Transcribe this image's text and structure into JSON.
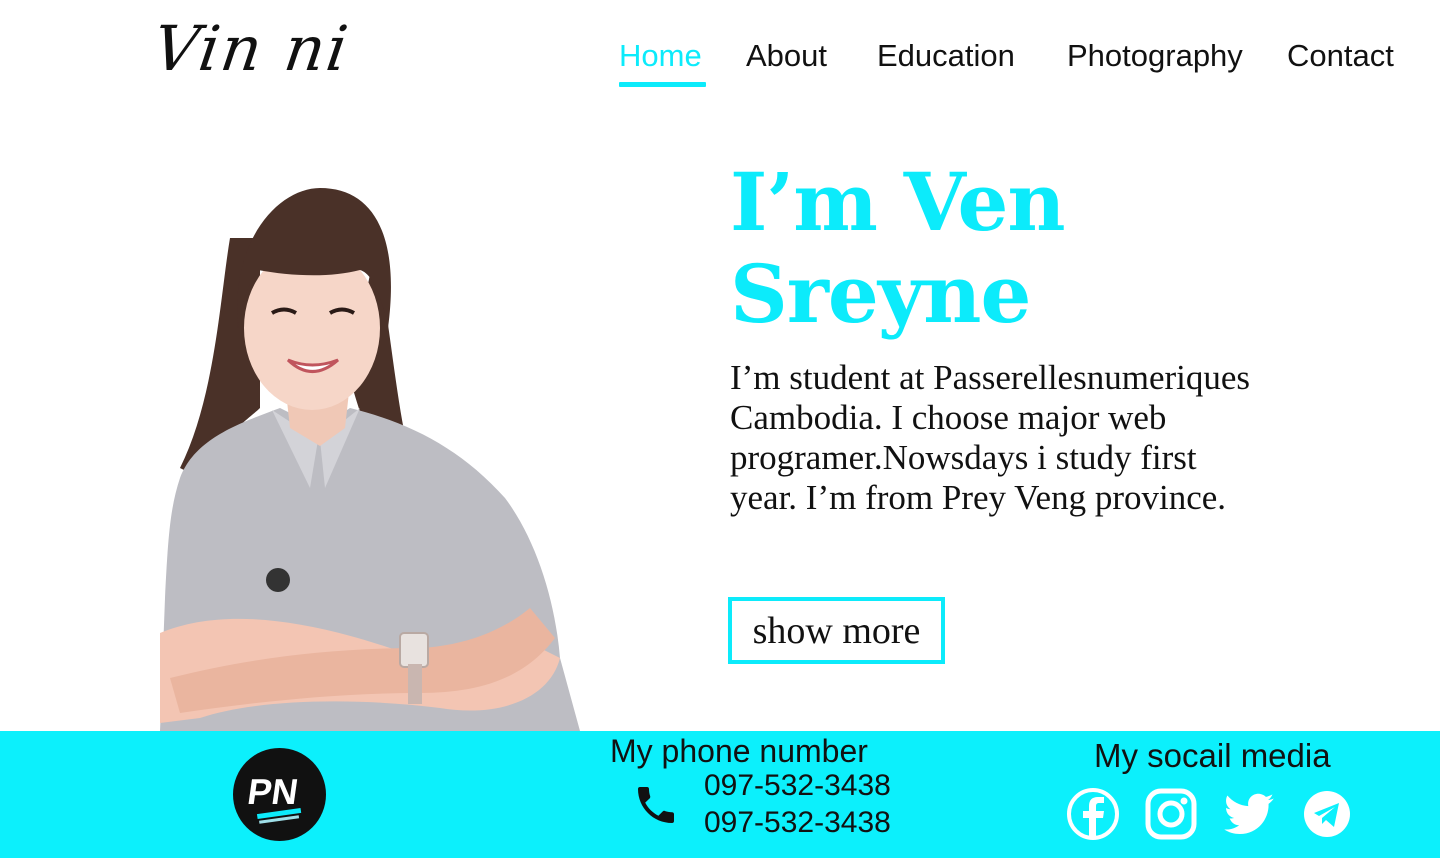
{
  "header": {
    "logo": "Vin ni",
    "nav": [
      {
        "label": "Home",
        "active": true
      },
      {
        "label": "About",
        "active": false
      },
      {
        "label": "Education",
        "active": false
      },
      {
        "label": "Photography",
        "active": false
      },
      {
        "label": "Contact",
        "active": false
      }
    ]
  },
  "hero": {
    "title_line1": "I’m Ven",
    "title_line2": "Sreyne",
    "description": "I’m student at Passerellesnumeriques Cambodia. I choose major web programer.Nowsdays i study first year. I’m from Prey Veng province.",
    "button_label": "show more"
  },
  "footer": {
    "logo_text": "PN",
    "phone_title": "My phone number",
    "phone_numbers": [
      "097-532-3438",
      "097-532-3438"
    ],
    "social_title": "My socail media",
    "social_icons": [
      "facebook-icon",
      "instagram-icon",
      "twitter-icon",
      "telegram-icon"
    ]
  },
  "colors": {
    "accent": "#0cebfb",
    "footer_bg": "#0cf0fc",
    "text": "#111111"
  }
}
